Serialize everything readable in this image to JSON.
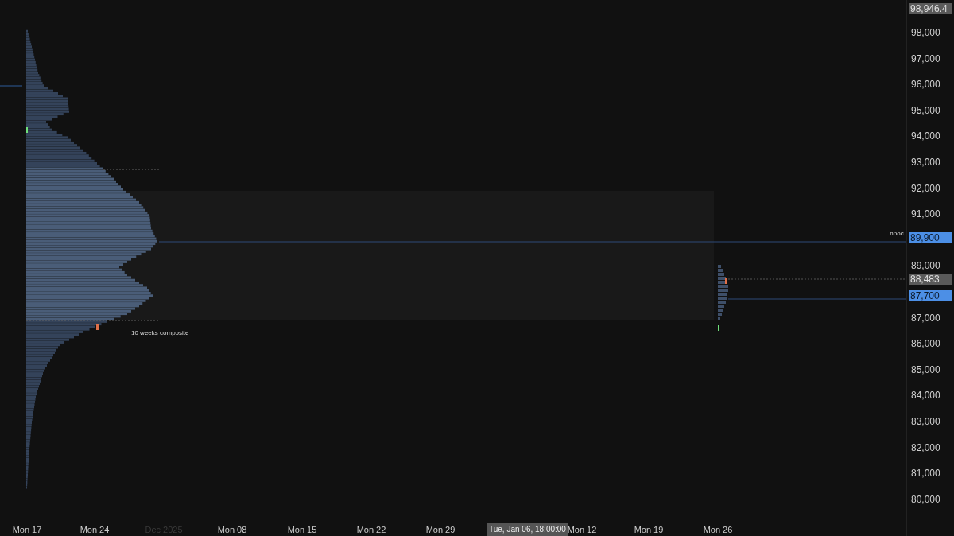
{
  "price_axis": {
    "labels": [
      "98,000",
      "97,000",
      "96,000",
      "95,000",
      "94,000",
      "93,000",
      "92,000",
      "91,000",
      "89,000",
      "87,000",
      "86,000",
      "85,000",
      "84,000",
      "83,000",
      "82,000",
      "81,000",
      "80,000"
    ]
  },
  "price_badges": [
    {
      "text": "98,946.4",
      "kind": "neutral"
    },
    {
      "text": "89,900",
      "kind": "highlight"
    },
    {
      "text": "88,483",
      "kind": "neutral"
    },
    {
      "text": "87,700",
      "kind": "highlight"
    }
  ],
  "profile_label": "10 weeks composite",
  "poc_label": "npoc",
  "time_axis": {
    "labels": [
      {
        "text": "Mon 17",
        "faded": false
      },
      {
        "text": "Mon 24",
        "faded": false
      },
      {
        "text": "Dec 2025",
        "faded": true
      },
      {
        "text": "Mon 08",
        "faded": false
      },
      {
        "text": "Mon 15",
        "faded": false
      },
      {
        "text": "Mon 22",
        "faded": false
      },
      {
        "text": "Mon 29",
        "faded": false
      },
      {
        "text": "Mon 12",
        "faded": false
      },
      {
        "text": "Mon 19",
        "faded": false
      },
      {
        "text": "Mon 26",
        "faded": false
      }
    ]
  },
  "crosshair_time": "Tue, Jan 06, 18:00:00"
}
